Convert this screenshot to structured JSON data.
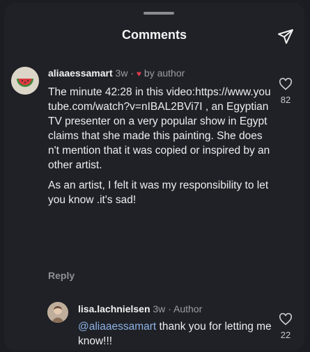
{
  "sheet": {
    "title": "Comments",
    "share_icon": "paper-plane-icon"
  },
  "comment": {
    "username": "aliaaessamart",
    "time": "3w",
    "separator": "·",
    "heart": "♥",
    "by_author": "by author",
    "paragraphs": [
      "The minute 42:28 in this video:https://www.youtube.com/watch?v=nIBAL2BVi7I , an Egyptian TV presenter on a very popular show in Egypt claims that she made this painting. She doesn't mention that it was copied or inspired by another artist.",
      "As an artist, I felt it was my responsibility to let you know .it's sad!"
    ],
    "reply_label": "Reply",
    "like_count": "82"
  },
  "reply": {
    "username": "lisa.lachnielsen",
    "time": "3w",
    "separator": "·",
    "author_label": "Author",
    "mention": "@aliaaessamart",
    "text": " thank you for letting me know!!!",
    "like_count": "22"
  },
  "colors": {
    "background": "#1f2126",
    "text": "#eceef0",
    "muted": "#9b9ea4",
    "mention": "#8fb3e6",
    "heart_red": "#e03a4a"
  }
}
